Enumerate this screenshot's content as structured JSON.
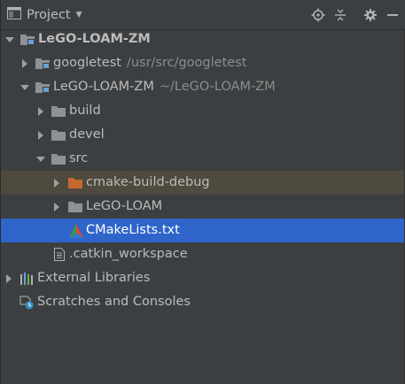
{
  "header": {
    "title": "Project",
    "tools": [
      "locate-icon",
      "collapse-all-icon",
      "gear-icon",
      "hide-icon"
    ]
  },
  "tree": {
    "root": {
      "label": "LeGO-LOAM-ZM"
    },
    "googletest": {
      "label": "googletest",
      "path": "/usr/src/googletest"
    },
    "lego_zm": {
      "label": "LeGO-LOAM-ZM",
      "path": "~/LeGO-LOAM-ZM"
    },
    "build": {
      "label": "build"
    },
    "devel": {
      "label": "devel"
    },
    "src": {
      "label": "src"
    },
    "cmake_build_debug": {
      "label": "cmake-build-debug"
    },
    "lego_loam": {
      "label": "LeGO-LOAM"
    },
    "cmakelists": {
      "label": "CMakeLists.txt"
    },
    "catkin_workspace": {
      "label": ".catkin_workspace"
    },
    "external_libraries": {
      "label": "External Libraries"
    },
    "scratches": {
      "label": "Scratches and Consoles"
    }
  },
  "colors": {
    "background": "#3c3f41",
    "selection": "#2f65ca",
    "highlight": "#4e4a3e",
    "folder": "#8c9297",
    "excluded_folder": "#c8692f",
    "path_text": "#8c8c8c"
  }
}
